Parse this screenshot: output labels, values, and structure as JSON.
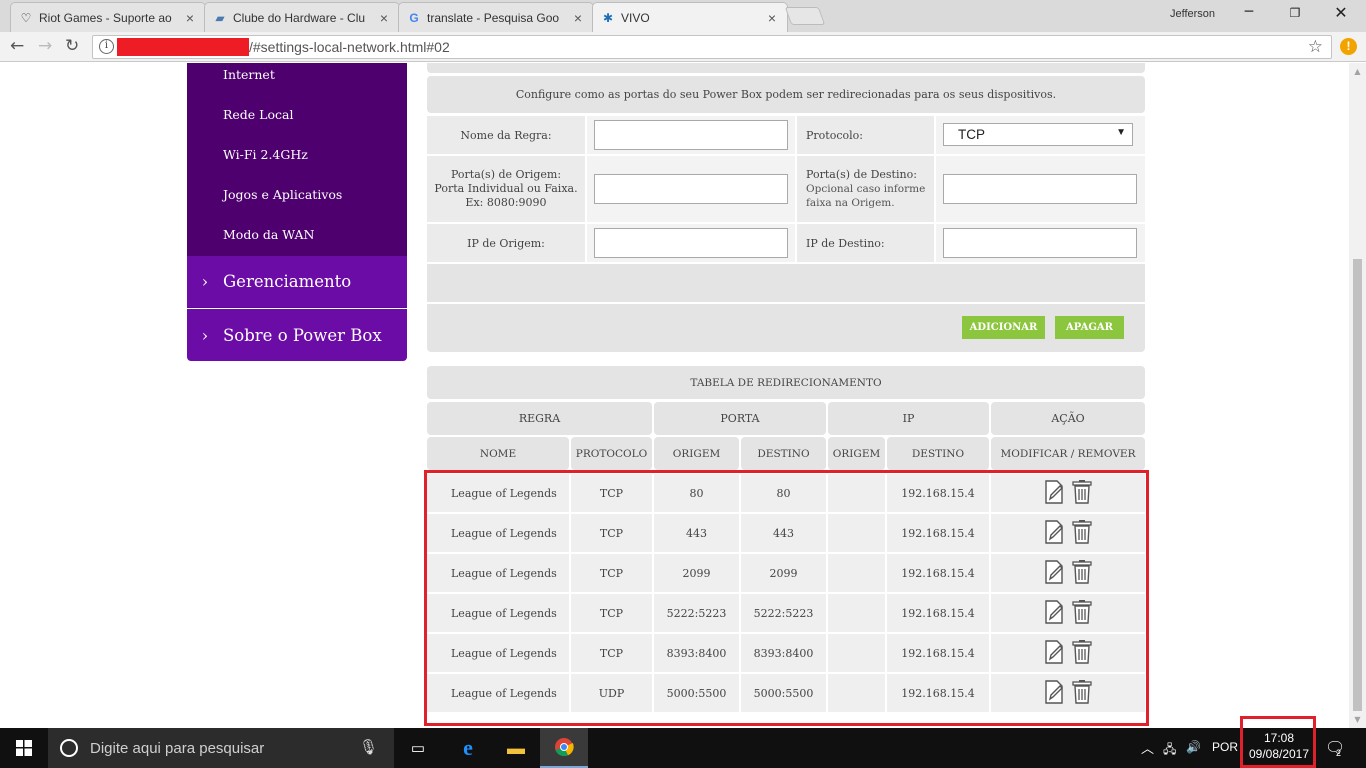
{
  "browser": {
    "tabs": [
      {
        "title": "Riot Games - Suporte ao",
        "icon": "heart-icon"
      },
      {
        "title": "Clube do Hardware - Clu",
        "icon": "chip-icon"
      },
      {
        "title": "translate - Pesquisa Goo",
        "icon": "google-icon"
      },
      {
        "title": "VIVO",
        "icon": "vivo-icon"
      }
    ],
    "profile": "Jefferson",
    "url_suffix": "/#settings-local-network.html#02"
  },
  "sidemenu": {
    "sub_items": [
      "Internet",
      "Rede Local",
      "Wi-Fi 2.4GHz",
      "Jogos e Aplicativos",
      "Modo da WAN"
    ],
    "main_items": [
      "Gerenciamento",
      "Sobre o Power Box"
    ]
  },
  "form": {
    "description": "Configure como as portas do seu Power Box podem ser redirecionadas para os seus dispositivos.",
    "rule_name_label": "Nome da Regra:",
    "rule_name_value": "",
    "protocol_label": "Protocolo:",
    "protocol_value": "TCP",
    "origin_ports_label": "Porta(s) de Origem:",
    "origin_ports_hint1": "Porta Individual ou Faixa.",
    "origin_ports_hint2": "Ex: 8080:9090",
    "origin_ports_value": "",
    "dest_ports_label": "Porta(s) de Destino:",
    "dest_ports_hint1": "Opcional caso informe",
    "dest_ports_hint2": "faixa na Origem.",
    "dest_ports_value": "",
    "origin_ip_label": "IP de Origem:",
    "origin_ip_value": "",
    "dest_ip_label": "IP de Destino:",
    "dest_ip_value": "",
    "add_button": "ADICIONAR",
    "clear_button": "APAGAR"
  },
  "table": {
    "title": "TABELA DE REDIRECIONAMENTO",
    "groups": [
      "REGRA",
      "PORTA",
      "IP",
      "AÇÃO"
    ],
    "columns": [
      "NOME",
      "PROTOCOLO",
      "ORIGEM",
      "DESTINO",
      "ORIGEM",
      "DESTINO",
      "MODIFICAR / REMOVER"
    ],
    "rows": [
      {
        "name": "League of Legends",
        "protocol": "TCP",
        "port_origin": "80",
        "port_dest": "80",
        "ip_origin": "",
        "ip_dest": "192.168.15.4"
      },
      {
        "name": "League of Legends",
        "protocol": "TCP",
        "port_origin": "443",
        "port_dest": "443",
        "ip_origin": "",
        "ip_dest": "192.168.15.4"
      },
      {
        "name": "League of Legends",
        "protocol": "TCP",
        "port_origin": "2099",
        "port_dest": "2099",
        "ip_origin": "",
        "ip_dest": "192.168.15.4"
      },
      {
        "name": "League of Legends",
        "protocol": "TCP",
        "port_origin": "5222:5223",
        "port_dest": "5222:5223",
        "ip_origin": "",
        "ip_dest": "192.168.15.4"
      },
      {
        "name": "League of Legends",
        "protocol": "TCP",
        "port_origin": "8393:8400",
        "port_dest": "8393:8400",
        "ip_origin": "",
        "ip_dest": "192.168.15.4"
      },
      {
        "name": "League of Legends",
        "protocol": "UDP",
        "port_origin": "5000:5500",
        "port_dest": "5000:5500",
        "ip_origin": "",
        "ip_dest": "192.168.15.4"
      }
    ]
  },
  "taskbar": {
    "search_placeholder": "Digite aqui para pesquisar",
    "language": "POR",
    "time": "17:08",
    "date": "09/08/2017",
    "notifications": "2"
  },
  "colors": {
    "menu_dark": "#4e006e",
    "menu_main": "#6c0ca6",
    "button_green": "#8cc63e",
    "highlight_red": "#e0202a"
  }
}
